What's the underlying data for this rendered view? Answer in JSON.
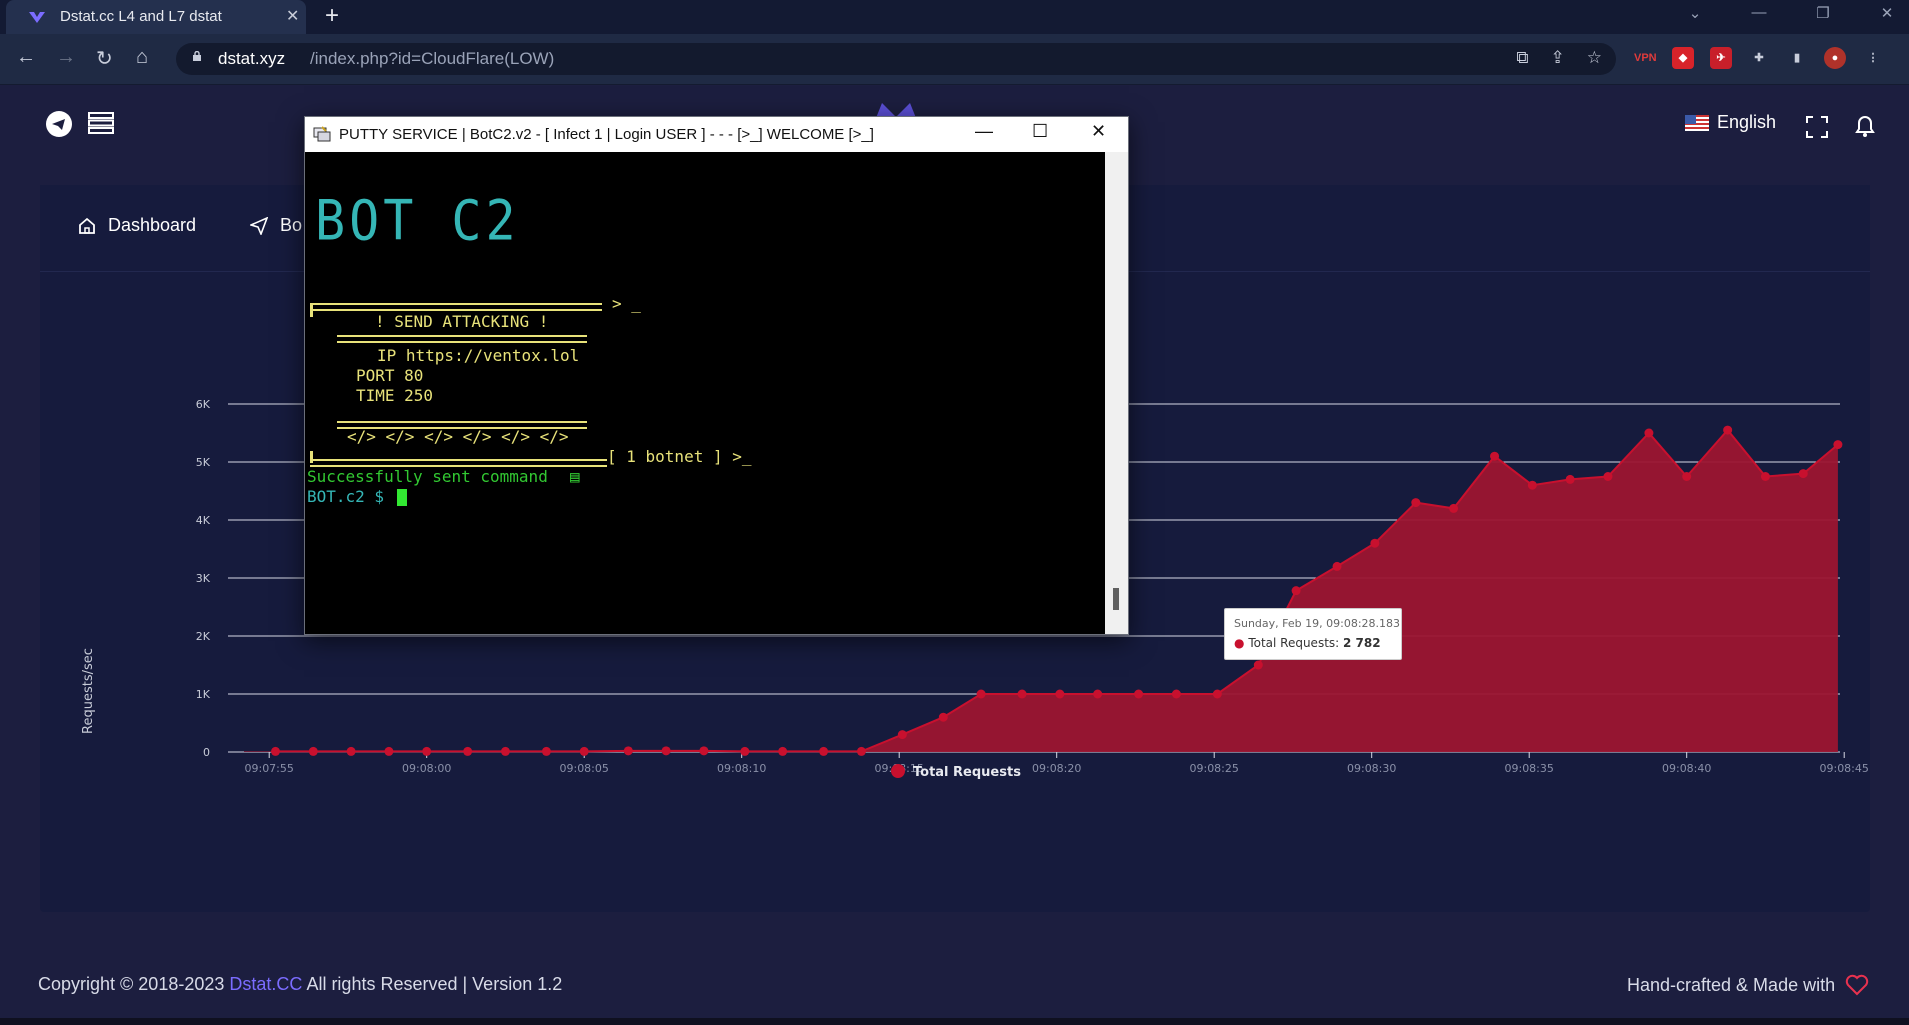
{
  "browser": {
    "tab_title": "Dstat.cc L4 and L7 dstat",
    "url_host": "dstat.xyz",
    "url_path": "/index.php?id=CloudFlare(LOW)"
  },
  "topbar": {
    "language": "English"
  },
  "nav": {
    "dashboard": "Dashboard",
    "bots_partial": "Bo"
  },
  "chart_data": {
    "type": "area",
    "ylabel": "Requests/sec",
    "yticks": [
      "0",
      "1K",
      "2K",
      "3K",
      "4K",
      "5K",
      "6K"
    ],
    "ylim": [
      0,
      6000
    ],
    "xticks": [
      "09:07:55",
      "09:08:00",
      "09:08:05",
      "09:08:10",
      "09:08:15",
      "09:08:20",
      "09:08:25",
      "09:08:30",
      "09:08:35",
      "09:08:40",
      "09:08:45"
    ],
    "x_seconds_from_0755": [
      1.0,
      2.2,
      3.4,
      4.6,
      5.8,
      7.1,
      8.3,
      9.6,
      10.8,
      12.2,
      13.4,
      14.6,
      15.9,
      17.1,
      18.4,
      19.6,
      20.9,
      22.2,
      23.4,
      24.7,
      25.9,
      27.1,
      28.4,
      29.6,
      30.9,
      32.2,
      33.4,
      34.7,
      35.9,
      37.2,
      38.4,
      39.7,
      40.9,
      42.1,
      43.3,
      44.6,
      45.8,
      47.1,
      48.3,
      49.5,
      50.6
    ],
    "series": [
      {
        "name": "Total Requests",
        "color": "#c8102e",
        "values": [
          10,
          10,
          10,
          10,
          10,
          10,
          10,
          10,
          10,
          20,
          20,
          20,
          10,
          10,
          10,
          10,
          300,
          600,
          1000,
          1000,
          1000,
          1000,
          1000,
          1000,
          1000,
          1500,
          2782,
          3200,
          3600,
          4300,
          4200,
          5100,
          4600,
          4700,
          4750,
          5500,
          4750,
          5550,
          4750,
          4800,
          5300
        ]
      }
    ],
    "legend": "bottom-center",
    "tooltip": {
      "date": "Sunday, Feb 19, 09:08:28.183",
      "label": "Total Requests:",
      "value": "2 782"
    }
  },
  "putty": {
    "title": "PUTTY SERVICE | BotC2.v2 - [ Infect 1 | Login USER ]  - - - [>_] WELCOME [>_]",
    "logo": "BOT C2",
    "prompt_arrow": "> _",
    "send_attacking": "! SEND ATTACKING !",
    "ip_line": "IP https://ventox.lol",
    "port_line": "PORT 80",
    "time_line": "TIME 250",
    "tags_line": "</> </> </> </> </> </>",
    "botnet_line": "[ 1 botnet ] >_",
    "success_line": "Successfully sent command",
    "shell_prompt": "BOT.c2 $"
  },
  "footer": {
    "copyright": "Copyright © 2018-2023",
    "brand": "Dstat.CC",
    "rights": "All rights Reserved | Version 1.2",
    "handcrafted": "Hand-crafted & Made with"
  }
}
